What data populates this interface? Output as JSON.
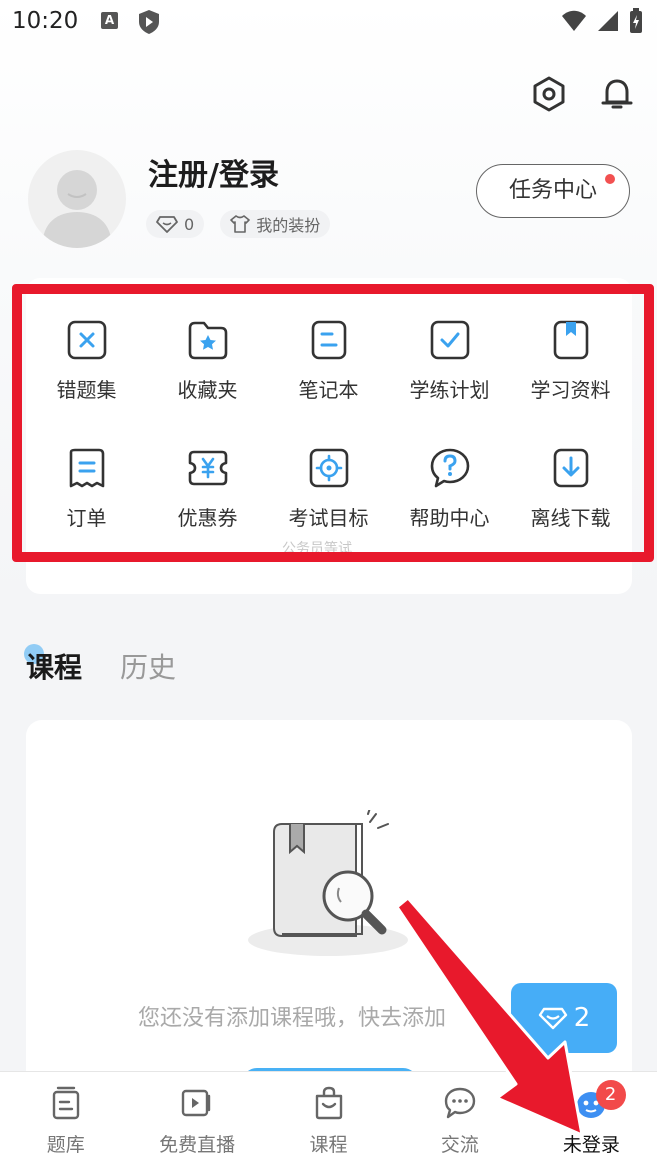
{
  "status_bar": {
    "time": "10:20",
    "a_icon": "A"
  },
  "header": {
    "settings_icon": "settings-hex-icon",
    "bell_icon": "bell-icon"
  },
  "profile": {
    "login_label": "注册/登录",
    "coin_count": "0",
    "outfit_label": "我的装扮",
    "task_center_label": "任务中心"
  },
  "grid": {
    "items": [
      {
        "label": "错题集",
        "icon": "wrong-questions-icon"
      },
      {
        "label": "收藏夹",
        "icon": "favorites-folder-icon"
      },
      {
        "label": "笔记本",
        "icon": "notebook-icon"
      },
      {
        "label": "学练计划",
        "icon": "study-plan-icon"
      },
      {
        "label": "学习资料",
        "icon": "study-materials-icon"
      },
      {
        "label": "订单",
        "icon": "order-icon"
      },
      {
        "label": "优惠券",
        "icon": "coupon-icon"
      },
      {
        "label": "考试目标",
        "icon": "exam-target-icon"
      },
      {
        "label": "帮助中心",
        "icon": "help-center-icon"
      },
      {
        "label": "离线下载",
        "icon": "offline-download-icon"
      }
    ],
    "ghost_text": "公务员等试"
  },
  "tabs": [
    {
      "label": "课程",
      "active": true
    },
    {
      "label": "历史",
      "active": false
    }
  ],
  "course_empty": {
    "text": "您还没有添加课程哦，快去添加"
  },
  "float_badge": {
    "count": "2"
  },
  "bottom_nav": {
    "items": [
      {
        "label": "题库",
        "icon": "question-bank-icon"
      },
      {
        "label": "免费直播",
        "icon": "live-video-icon"
      },
      {
        "label": "课程",
        "icon": "course-bag-icon"
      },
      {
        "label": "交流",
        "icon": "chat-bubble-icon"
      },
      {
        "label": "未登录",
        "icon": "mascot-icon",
        "badge": "2"
      }
    ]
  },
  "colors": {
    "accent": "#46adf7",
    "highlight_box": "#e8192c",
    "badge": "#f24a4a"
  }
}
